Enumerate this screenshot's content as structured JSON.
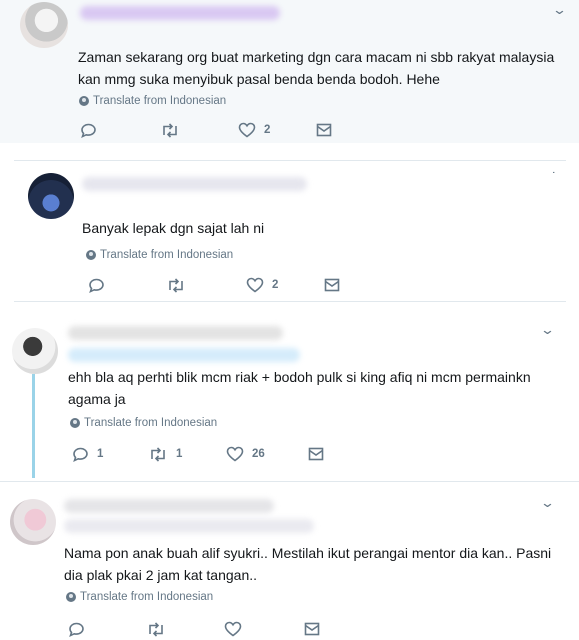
{
  "tweets": [
    {
      "text": "Zaman sekarang org buat marketing dgn cara macam ni sbb rakyat malaysia kan mmg suka menyibuk pasal benda benda bodoh. Hehe",
      "translate": "Translate from Indonesian",
      "replies": "",
      "retweets": "",
      "likes": "2"
    },
    {
      "text": "Banyak lepak dgn sajat lah ni",
      "translate": "Translate from Indonesian",
      "replies": "",
      "retweets": "",
      "likes": "2"
    },
    {
      "text": "ehh bla aq perhti blik mcm riak + bodoh pulk si king afiq ni mcm permainkn agama ja",
      "translate": "Translate from Indonesian",
      "replies": "1",
      "retweets": "1",
      "likes": "26"
    },
    {
      "text": "Nama pon anak buah alif syukri.. Mestilah ikut perangai mentor dia kan.. Pasni dia plak pkai 2 jam kat tangan..",
      "translate": "Translate from Indonesian",
      "replies": "",
      "retweets": "",
      "likes": ""
    }
  ],
  "icons": {
    "reply": "reply-icon",
    "retweet": "retweet-icon",
    "like": "heart-icon",
    "dm": "envelope-icon",
    "more": "chevron-down-icon",
    "translate": "globe-icon"
  },
  "colors": {
    "meta": "#657786",
    "thread": "#9ad3e8",
    "highlight_bg": "#f5f8fa"
  }
}
